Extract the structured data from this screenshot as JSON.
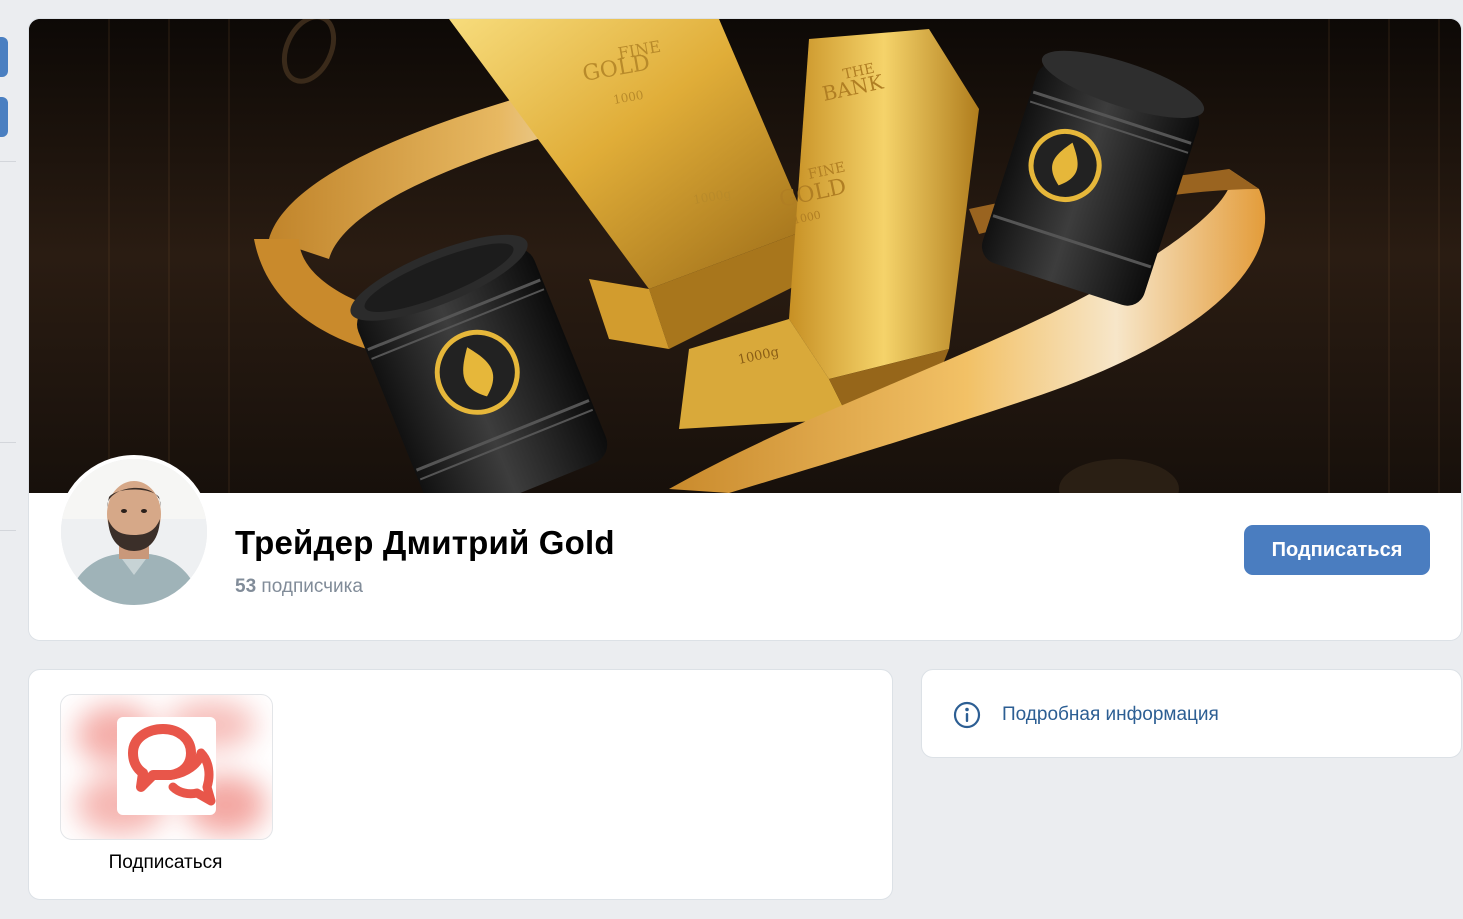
{
  "profile": {
    "name": "Трейдер Дмитрий Gold",
    "followers_count": "53",
    "followers_label": "подписчика",
    "subscribe_label": "Подписаться"
  },
  "widget": {
    "app_label": "Подписаться"
  },
  "info": {
    "label": "Подробная информация"
  },
  "cover": {
    "bar1_lines": [
      "FINE",
      "GOLD",
      "1000",
      "1000g"
    ],
    "bar2_lines": [
      "THE",
      "BANK",
      "FINE",
      "GOLD",
      "1000",
      "1000g"
    ]
  },
  "colors": {
    "accent": "#4a7dc0",
    "link": "#2c5e93",
    "secondary_text": "#818c99",
    "background": "#ebedf0",
    "gold": "#d9a93a",
    "app_logo": "#e8564a"
  },
  "icons": {
    "info": "info-circle-icon",
    "app_logo": "chat-bubble-logo-icon"
  }
}
